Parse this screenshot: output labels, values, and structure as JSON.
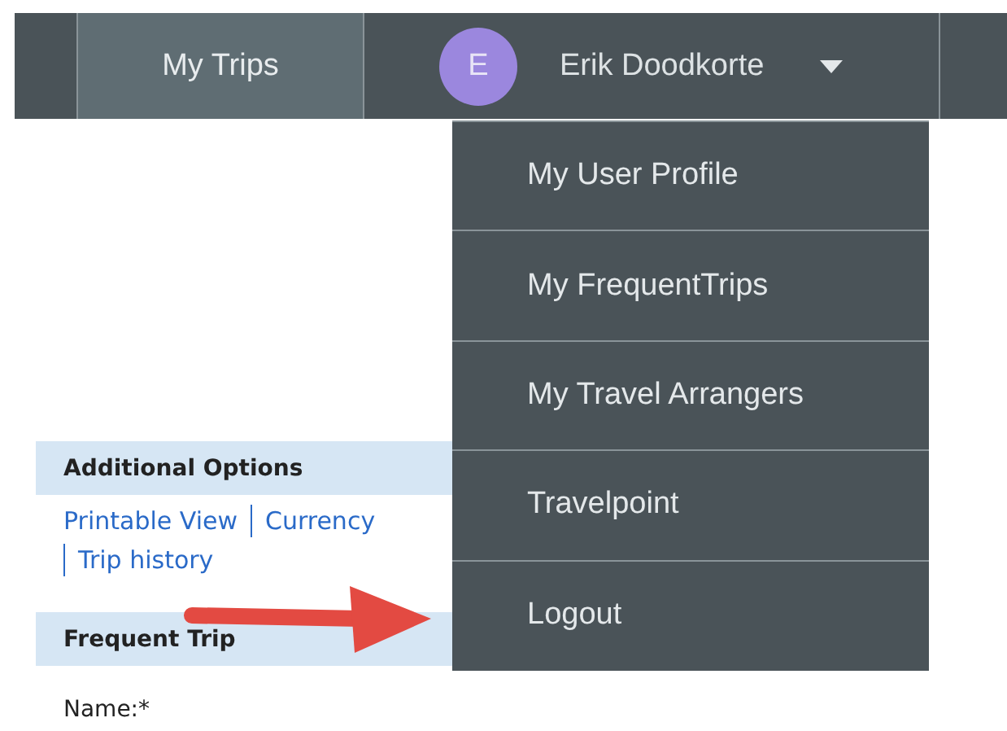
{
  "navbar": {
    "tabs": [
      {
        "label": "My Trips",
        "selected": true
      }
    ],
    "user": {
      "initial": "E",
      "name": "Erik Doodkorte",
      "expanded": true
    }
  },
  "user_menu": {
    "items": [
      {
        "label": "My User Profile"
      },
      {
        "label": "My FrequentTrips"
      },
      {
        "label": "My Travel Arrangers"
      },
      {
        "label": "Travelpoint"
      },
      {
        "label": "Logout"
      }
    ]
  },
  "additional_options": {
    "title": "Additional Options",
    "links": [
      "Printable View",
      "Currency",
      "Trip history"
    ]
  },
  "frequent_trip": {
    "title": "Frequent Trip",
    "fields": [
      {
        "label": "Name:*"
      }
    ]
  }
}
